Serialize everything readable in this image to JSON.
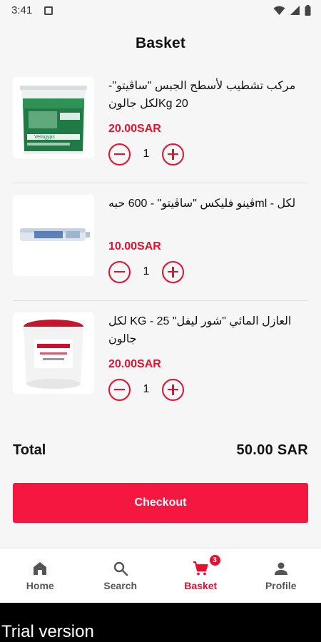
{
  "status_bar": {
    "time": "3:41"
  },
  "header": {
    "title": "Basket"
  },
  "items": [
    {
      "name": "مركب تشطيب لأسطح الجبس \"ساڤيتو\"- 20 Kgلكل جالون",
      "price": "20.00SAR",
      "quantity": "1",
      "image_icon": "bucket-product-image",
      "image_label": "Vetogyps"
    },
    {
      "name": "لكل - mlڤينو فليكس \"ساڤيتو\" - 600 حبه",
      "price": "10.00SAR",
      "quantity": "1",
      "image_icon": "sealant-tube-product-image"
    },
    {
      "name": "العازل المائي \"شور ليفل\" KG - 25 لكل جالون",
      "price": "20.00SAR",
      "quantity": "1",
      "image_icon": "bucket-product-image"
    }
  ],
  "summary": {
    "total_label": "Total",
    "total_value": "50.00 SAR"
  },
  "checkout": {
    "label": "Checkout"
  },
  "nav": {
    "home": {
      "label": "Home",
      "icon": "home-icon"
    },
    "search": {
      "label": "Search",
      "icon": "search-icon"
    },
    "basket": {
      "label": "Basket",
      "icon": "cart-icon",
      "badge": "3"
    },
    "profile": {
      "label": "Profile",
      "icon": "person-icon"
    }
  },
  "trial": {
    "text": "Trial version"
  },
  "colors": {
    "accent": "#e8102e",
    "checkout": "#f5173f",
    "background": "#f6f6f6"
  }
}
